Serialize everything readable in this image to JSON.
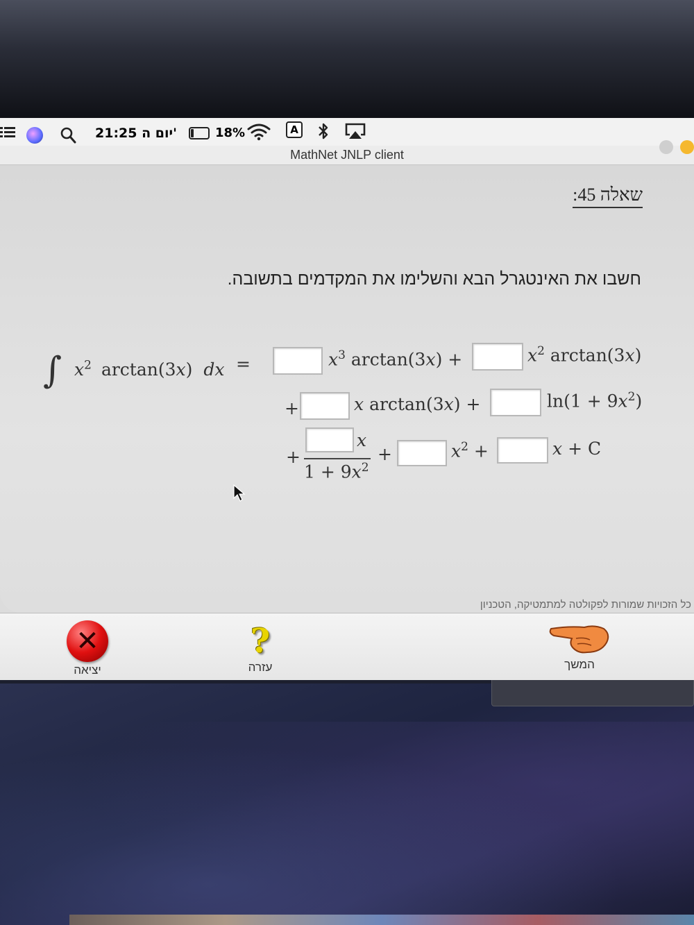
{
  "menubar": {
    "clock": "21:25 יום ה'",
    "battery_percent": "18%",
    "input_source": "A",
    "battery_level": 0.18
  },
  "window": {
    "title": "MathNet JNLP client"
  },
  "question": {
    "title": "שאלה 45:",
    "instruction": "חשבו את האינטגרל הבא והשלימו את המקדמים בתשובה.",
    "lhs": {
      "integral": "∫",
      "x": "x",
      "sq": "2",
      "fn": "arctan(3",
      "x2": "x",
      "close": ")",
      "d": "d",
      "x3": "x"
    },
    "equals": "=",
    "line1": {
      "t1_x": "x",
      "t1_exp": "3",
      "t1_fn": "arctan(3",
      "t1_x2": "x",
      "t1_close": ") +",
      "t2_x": "x",
      "t2_exp": "2",
      "t2_fn": "arctan(3",
      "t2_x2": "x",
      "t2_close": ")"
    },
    "line2": {
      "plus": "+",
      "t3_x": "x",
      "t3_fn": "arctan(3",
      "t3_x2": "x",
      "t3_close": ") +",
      "t4_fn": "ln(1 + 9",
      "t4_x": "x",
      "t4_exp": "2",
      "t4_close": ")"
    },
    "line3": {
      "plus": "+",
      "frac_num": "x",
      "frac_den": "1 + 9",
      "frac_den_x": "x",
      "frac_den_exp": "2",
      "plus2": "+",
      "t6_x": "x",
      "t6_exp": "2",
      "t6_plus": "+",
      "t7_x": "x",
      "t7_rest": "+ C"
    },
    "answers": [
      "",
      "",
      "",
      "",
      "",
      "",
      ""
    ]
  },
  "footer": {
    "copyright": "כל הזכויות שמורות לפקולטה למתמטיקה, הטכניון"
  },
  "buttons": {
    "exit_label": "יציאה",
    "help_label": "עזרה",
    "next_label": "המשך",
    "exit_glyph": "✕",
    "help_glyph": "?"
  },
  "icons": {
    "exit": "close-x-icon",
    "help": "question-mark-icon",
    "next": "pointing-hand-icon"
  },
  "colors": {
    "exit_red": "#e01010",
    "help_yellow": "#e8d400",
    "hand_orange": "#f08a40"
  }
}
